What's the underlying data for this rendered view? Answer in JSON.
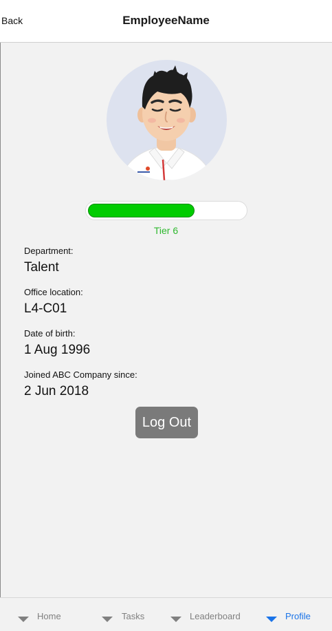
{
  "header": {
    "back_label": "Back",
    "title": "EmployeeName"
  },
  "profile": {
    "avatar": "avatar-illustration",
    "tier_progress": 0.68,
    "tier_label": "Tier 6",
    "fields": [
      {
        "label": "Department:",
        "value": "Talent"
      },
      {
        "label": "Office location:",
        "value": "L4-C01"
      },
      {
        "label": "Date of birth:",
        "value": "1 Aug 1996"
      },
      {
        "label": "Joined ABC Company since:",
        "value": "2 Jun 2018"
      }
    ]
  },
  "actions": {
    "logout_label": "Log Out"
  },
  "tabs": [
    {
      "label": "Home",
      "icon": "triangle-down-icon",
      "active": false
    },
    {
      "label": "Tasks",
      "icon": "triangle-down-icon",
      "active": false
    },
    {
      "label": "Leaderboard",
      "icon": "triangle-down-icon",
      "active": false
    },
    {
      "label": "Profile",
      "icon": "triangle-down-icon",
      "active": true
    }
  ],
  "colors": {
    "progress_fill": "#00cc00",
    "tier_text": "#2eb82e",
    "active_tab": "#1a73e8",
    "inactive_tab": "#808080",
    "logout_bg": "#7a7a7a"
  }
}
